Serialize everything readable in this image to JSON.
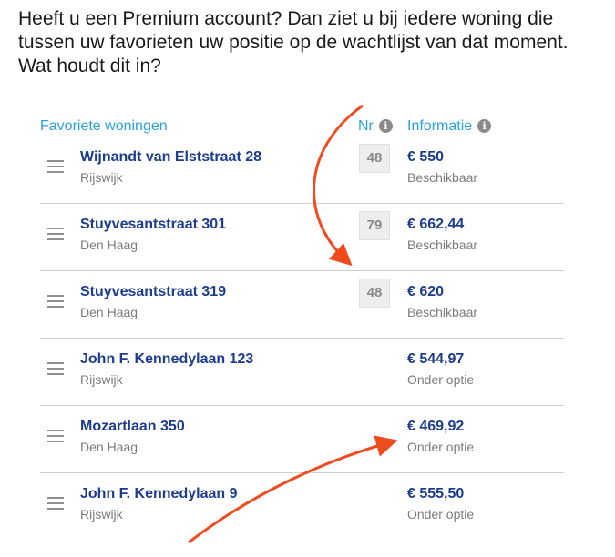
{
  "question": "Heeft u een Premium account? Dan ziet u bij iedere woning die tussen uw favorieten uw positie op de wachtlijst van dat moment. Wat houdt dit in?",
  "headers": {
    "favorites": "Favoriete woningen",
    "nr": "Nr",
    "info": "Informatie",
    "info_icon_glyph": "i"
  },
  "rows": [
    {
      "street": "Wijnandt van Elststraat 28",
      "city": "Rijswijk",
      "nr": "48",
      "price": "€ 550",
      "status": "Beschikbaar"
    },
    {
      "street": "Stuyvesantstraat 301",
      "city": "Den Haag",
      "nr": "79",
      "price": "€ 662,44",
      "status": "Beschikbaar"
    },
    {
      "street": "Stuyvesantstraat 319",
      "city": "Den Haag",
      "nr": "48",
      "price": "€ 620",
      "status": "Beschikbaar"
    },
    {
      "street": "John F. Kennedylaan 123",
      "city": "Rijswijk",
      "nr": "",
      "price": "€ 544,97",
      "status": "Onder optie"
    },
    {
      "street": "Mozartlaan 350",
      "city": "Den Haag",
      "nr": "",
      "price": "€ 469,92",
      "status": "Onder optie"
    },
    {
      "street": "John F. Kennedylaan 9",
      "city": "Rijswijk",
      "nr": "",
      "price": "€ 555,50",
      "status": "Onder optie"
    }
  ],
  "colors": {
    "accent": "#2aa3dd",
    "link": "#1b3c8f",
    "muted": "#7c7c7c",
    "annotation_arrow": "#f04b1f"
  },
  "icons": [
    "drag-handle-icon",
    "info-icon",
    "annotation-arrow"
  ]
}
